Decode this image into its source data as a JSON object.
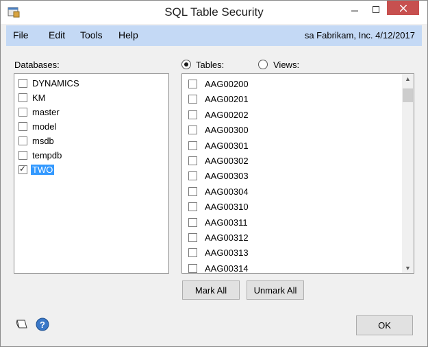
{
  "window": {
    "title": "SQL Table Security"
  },
  "menu": {
    "items": [
      "File",
      "Edit",
      "Tools",
      "Help"
    ],
    "user_info": "sa  Fabrikam, Inc.  4/12/2017"
  },
  "databases": {
    "label": "Databases:",
    "items": [
      {
        "name": "DYNAMICS",
        "checked": false,
        "selected": false
      },
      {
        "name": "KM",
        "checked": false,
        "selected": false
      },
      {
        "name": "master",
        "checked": false,
        "selected": false
      },
      {
        "name": "model",
        "checked": false,
        "selected": false
      },
      {
        "name": "msdb",
        "checked": false,
        "selected": false
      },
      {
        "name": "tempdb",
        "checked": false,
        "selected": false
      },
      {
        "name": "TWO",
        "checked": true,
        "selected": true
      }
    ]
  },
  "mode": {
    "tables_label": "Tables:",
    "views_label": "Views:",
    "selected": "tables"
  },
  "tables": {
    "items": [
      "AAG00200",
      "AAG00201",
      "AAG00202",
      "AAG00300",
      "AAG00301",
      "AAG00302",
      "AAG00303",
      "AAG00304",
      "AAG00310",
      "AAG00311",
      "AAG00312",
      "AAG00313",
      "AAG00314"
    ]
  },
  "buttons": {
    "mark_all": "Mark All",
    "unmark_all": "Unmark All",
    "ok": "OK"
  },
  "icons": {
    "app": "table-security-icon",
    "note": "note-icon",
    "help": "help-icon"
  }
}
